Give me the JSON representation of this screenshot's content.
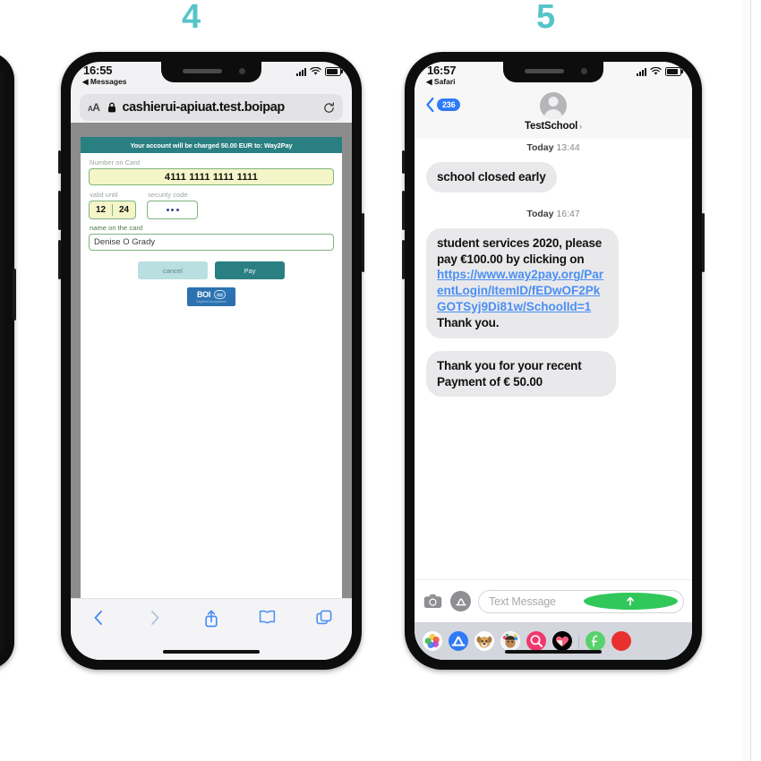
{
  "steps": [
    {
      "label": "4"
    },
    {
      "label": "5"
    }
  ],
  "theme": {
    "step_number_color": "#56c4c8",
    "bank_teal": "#2a7f82",
    "ios_blue": "#4b8ff5",
    "badge_blue": "#2f7bf6",
    "send_green": "#31c75a"
  },
  "phone_safari": {
    "status": {
      "time": "16:55",
      "back_label": "◀ Messages",
      "signal_icon": "signal-bars-icon",
      "wifi_icon": "wifi-icon",
      "battery_icon": "battery-icon"
    },
    "browser": {
      "text_size_label": "AA",
      "lock_icon": "lock-icon",
      "url": "cashierui-apiuat.test.boipap",
      "reload_icon": "reload-icon"
    },
    "payment_form": {
      "banner": "Your account will be charged 50.00 EUR to: Way2Pay",
      "card_number_label": "Number on Card",
      "card_number_value": "4111 1111 1111 1111",
      "valid_until_label": "valid until",
      "expiry_month": "12",
      "expiry_year": "24",
      "security_code_label": "security code",
      "security_code_value": "•••",
      "name_label": "name on the card",
      "name_value": "Denise O Grady",
      "cancel_button": "cancel",
      "pay_button": "Pay",
      "logo_text": "BOI",
      "logo_subtitle": "Payment Acceptance"
    },
    "toolbar": {
      "back_icon": "chevron-left-icon",
      "forward_icon": "chevron-right-icon",
      "share_icon": "share-icon",
      "bookmarks_icon": "book-icon",
      "tabs_icon": "tabs-icon"
    }
  },
  "phone_messages": {
    "status": {
      "time": "16:57",
      "back_label": "◀ Safari",
      "signal_icon": "signal-bars-icon",
      "wifi_icon": "wifi-icon",
      "battery_icon": "battery-icon"
    },
    "nav": {
      "back_icon": "chevron-left-icon",
      "unread_count": "236",
      "avatar_icon": "person-avatar-icon",
      "contact_name": "TestSchool",
      "contact_chevron": "›"
    },
    "thread": [
      {
        "timestamp_day": "Today",
        "timestamp_time": "13:44",
        "type": "text",
        "text": "school closed early"
      },
      {
        "timestamp_day": "Today",
        "timestamp_time": "16:47",
        "type": "link",
        "text_before": "student services 2020, please pay €100.00 by clicking on",
        "link_text": "https://www.way2pay.org/ParentLogin/ItemID/fEDwOF2PkGOTSyj9Di81w/SchoolId=1",
        "text_after": "Thank you."
      },
      {
        "type": "text",
        "text": "Thank you for your recent Payment of € 50.00"
      }
    ],
    "compose": {
      "camera_icon": "camera-icon",
      "appstore_icon": "app-store-icon",
      "placeholder": "Text Message",
      "send_icon": "send-arrow-up-icon"
    },
    "app_drawer": [
      {
        "name": "photos-app-icon"
      },
      {
        "name": "app-store-app-icon"
      },
      {
        "name": "memoji-dog-icon"
      },
      {
        "name": "memoji-person-icon"
      },
      {
        "name": "image-search-app-icon"
      },
      {
        "name": "digital-touch-heart-icon"
      },
      {
        "name": "green-app-icon"
      },
      {
        "name": "red-app-icon"
      }
    ]
  }
}
